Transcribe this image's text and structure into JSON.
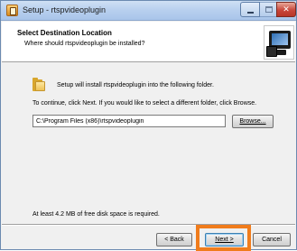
{
  "window": {
    "title": "Setup - rtspvideoplugin",
    "minimize_glyph": "",
    "close_glyph": "✕"
  },
  "header": {
    "title": "Select Destination Location",
    "subtitle": "Where should rtspvideoplugin be installed?"
  },
  "body": {
    "install_text": "Setup will install rtspvideoplugin into the following folder.",
    "continue_text": "To continue, click Next. If you would like to select a different folder, click Browse.",
    "path_value": "C:\\Program Files (x86)\\rtspvideoplugin",
    "browse_label": "Browse...",
    "space_text": "At least 4.2 MB of free disk space is required."
  },
  "footer": {
    "back_label": "< Back",
    "next_label": "Next >",
    "cancel_label": "Cancel"
  },
  "colors": {
    "highlight": "#f07c1c",
    "titlebar": "#b7cfee",
    "close_button": "#c8463a"
  },
  "icons": [
    "setup-app-icon",
    "wizard-monitor-icon",
    "folder-icon",
    "minimize-icon",
    "maximize-icon",
    "close-icon"
  ]
}
